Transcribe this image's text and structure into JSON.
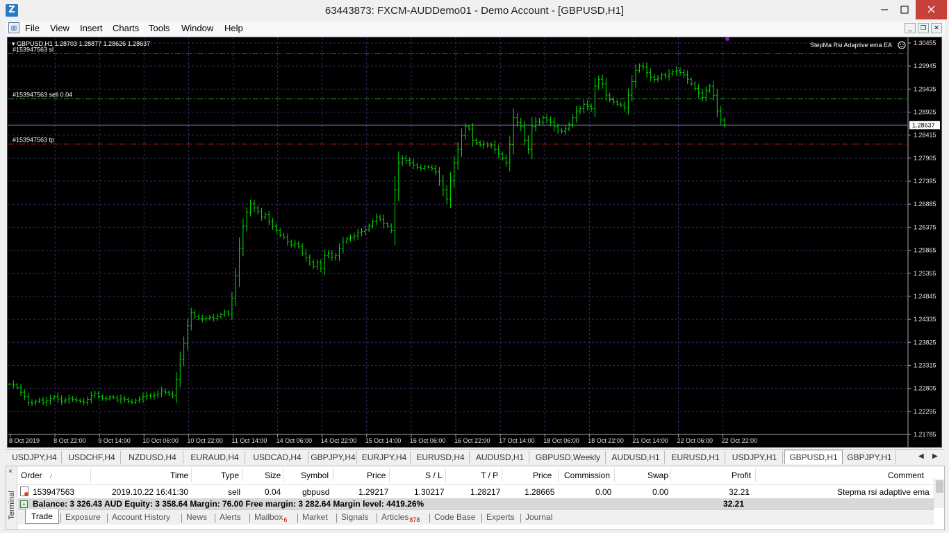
{
  "window": {
    "title": "63443873: FXCM-AUDDemo01 - Demo Account - [GBPUSD,H1]",
    "app_icon_glyph": "Z",
    "minimize_icon": "minimize-icon",
    "maximize_icon": "maximize-icon",
    "close_icon": "close-icon"
  },
  "menu": {
    "items": [
      "File",
      "View",
      "Insert",
      "Charts",
      "Tools",
      "Window",
      "Help"
    ]
  },
  "chart": {
    "header": "GBPUSD,H1  1.28703 1.28877 1.28626 1.28637",
    "ea_label": "StepMa Rsi Adaptive ema EA",
    "ea_icon": "smiley-face-icon",
    "sl_label": "#153947563 sl",
    "order_label": "#153947563 sell 0.04",
    "tp_label": "#153947563 tp",
    "current_price_label": "1.28637",
    "colors": {
      "background": "#000000",
      "candles": "#00e000",
      "grid": "#3a2a6a",
      "sl_tp_line": "#e02020",
      "order_line": "#30b030",
      "bid_line": "#8080c0"
    }
  },
  "chart_data": {
    "type": "bar",
    "title": "GBPUSD,H1",
    "y_ticks": [
      "1.30455",
      "1.29945",
      "1.29435",
      "1.28925",
      "1.28415",
      "1.27905",
      "1.27395",
      "1.26885",
      "1.26375",
      "1.25865",
      "1.25355",
      "1.24845",
      "1.24335",
      "1.23825",
      "1.23315",
      "1.22805",
      "1.22295",
      "1.21785"
    ],
    "x_ticks": [
      "8 Oct 2019",
      "8 Oct 22:00",
      "9 Oct 14:00",
      "10 Oct 06:00",
      "10 Oct 22:00",
      "11 Oct 14:00",
      "14 Oct 06:00",
      "14 Oct 22:00",
      "15 Oct 14:00",
      "16 Oct 06:00",
      "16 Oct 22:00",
      "17 Oct 14:00",
      "18 Oct 06:00",
      "18 Oct 22:00",
      "21 Oct 14:00",
      "22 Oct 06:00",
      "22 Oct 22:00"
    ],
    "ylim": [
      1.21785,
      1.30455
    ],
    "grid": true,
    "levels": {
      "stop_loss": 1.30217,
      "order_open": 1.29217,
      "take_profit": 1.28217,
      "bid": 1.28637
    },
    "close_series": [
      1.229,
      1.2288,
      1.2282,
      1.2272,
      1.2262,
      1.225,
      1.2248,
      1.2252,
      1.2255,
      1.225,
      1.2253,
      1.2258,
      1.2262,
      1.2257,
      1.2252,
      1.2255,
      1.2258,
      1.2256,
      1.2254,
      1.2252,
      1.225,
      1.2256,
      1.2265,
      1.227,
      1.2262,
      1.2258,
      1.2257,
      1.2262,
      1.226,
      1.2255,
      1.2258,
      1.2256,
      1.2252,
      1.225,
      1.2254,
      1.2257,
      1.2262,
      1.2265,
      1.2263,
      1.2266,
      1.227,
      1.2275,
      1.2272,
      1.2268,
      1.2265,
      1.23,
      1.2345,
      1.238,
      1.242,
      1.2448,
      1.244,
      1.2436,
      1.2434,
      1.2436,
      1.2438,
      1.2436,
      1.244,
      1.2444,
      1.245,
      1.2445,
      1.248,
      1.253,
      1.259,
      1.264,
      1.267,
      1.269,
      1.268,
      1.2672,
      1.266,
      1.2665,
      1.265,
      1.264,
      1.263,
      1.262,
      1.2615,
      1.2605,
      1.2598,
      1.2602,
      1.2595,
      1.258,
      1.257,
      1.256,
      1.255,
      1.256,
      1.2545,
      1.2575,
      1.258,
      1.257,
      1.2575,
      1.259,
      1.2605,
      1.2612,
      1.2615,
      1.2618,
      1.2625,
      1.2628,
      1.2632,
      1.264,
      1.265,
      1.266,
      1.2655,
      1.2645,
      1.264,
      1.263,
      1.272,
      1.278,
      1.279,
      1.2785,
      1.278,
      1.2775,
      1.277,
      1.2768,
      1.2772,
      1.277,
      1.2768,
      1.276,
      1.274,
      1.272,
      1.27,
      1.274,
      1.278,
      1.281,
      1.284,
      1.286,
      1.2855,
      1.283,
      1.2825,
      1.282,
      1.2822,
      1.2818,
      1.282,
      1.281,
      1.28,
      1.279,
      1.278,
      1.282,
      1.288,
      1.287,
      1.286,
      1.283,
      1.281,
      1.286,
      1.2872,
      1.287,
      1.288,
      1.2875,
      1.287,
      1.286,
      1.2852,
      1.285,
      1.2855,
      1.2865,
      1.288,
      1.2895,
      1.29,
      1.291,
      1.2905,
      1.29,
      1.295,
      1.2965,
      1.2955,
      1.293,
      1.292,
      1.2915,
      1.291,
      1.2908,
      1.2902,
      1.293,
      1.296,
      1.2985,
      1.2995,
      1.2992,
      1.298,
      1.297,
      1.2965,
      1.2968,
      1.2975,
      1.2972,
      1.2978,
      1.2982,
      1.2985,
      1.298,
      1.2975,
      1.2965,
      1.2955,
      1.2945,
      1.2935,
      1.2925,
      1.294,
      1.295,
      1.293,
      1.2895,
      1.2875,
      1.2864
    ]
  },
  "symbol_tabs": {
    "items": [
      "USDJPY,H4",
      "USDCHF,H4",
      "NZDUSD,H4",
      "EURAUD,H4",
      "USDCAD,H4",
      "GBPJPY,H4",
      "EURJPY,H4",
      "EURUSD,H4",
      "AUDUSD,H1",
      "GBPUSD,Weekly",
      "AUDUSD,H1",
      "EURUSD,H1",
      "USDJPY,H1",
      "GBPUSD,H1",
      "GBPJPY,H1"
    ],
    "active": "GBPUSD,H1",
    "nav_left_icon": "chevron-left-icon",
    "nav_right_icon": "chevron-right-icon"
  },
  "terminal": {
    "side_label": "Terminal",
    "close_glyph": "×",
    "columns": [
      "Order",
      "/",
      "Time",
      "Type",
      "Size",
      "Symbol",
      "Price",
      "S / L",
      "T / P",
      "Price",
      "Commission",
      "Swap",
      "Profit",
      "Comment"
    ],
    "order": {
      "order": "153947563",
      "time": "2019.10.22 16:41:30",
      "type": "sell",
      "size": "0.04",
      "symbol": "gbpusd",
      "price": "1.29217",
      "sl": "1.30217",
      "tp": "1.28217",
      "current_price": "1.28665",
      "commission": "0.00",
      "swap": "0.00",
      "profit": "32.21",
      "comment": "Stepma rsi adaptive ema",
      "close_glyph": "×"
    },
    "balance_line": "Balance: 3 326.43 AUD  Equity: 3 358.64  Margin: 76.00  Free margin: 3 282.64  Margin level: 4419.26%",
    "total_profit": "32.21",
    "tabs": [
      {
        "label": "Trade"
      },
      {
        "label": "Exposure"
      },
      {
        "label": "Account History"
      },
      {
        "label": "News"
      },
      {
        "label": "Alerts"
      },
      {
        "label": "Mailbox",
        "badge": "6"
      },
      {
        "label": "Market"
      },
      {
        "label": "Signals"
      },
      {
        "label": "Articles",
        "badge": "878"
      },
      {
        "label": "Code Base"
      },
      {
        "label": "Experts"
      },
      {
        "label": "Journal"
      }
    ]
  }
}
